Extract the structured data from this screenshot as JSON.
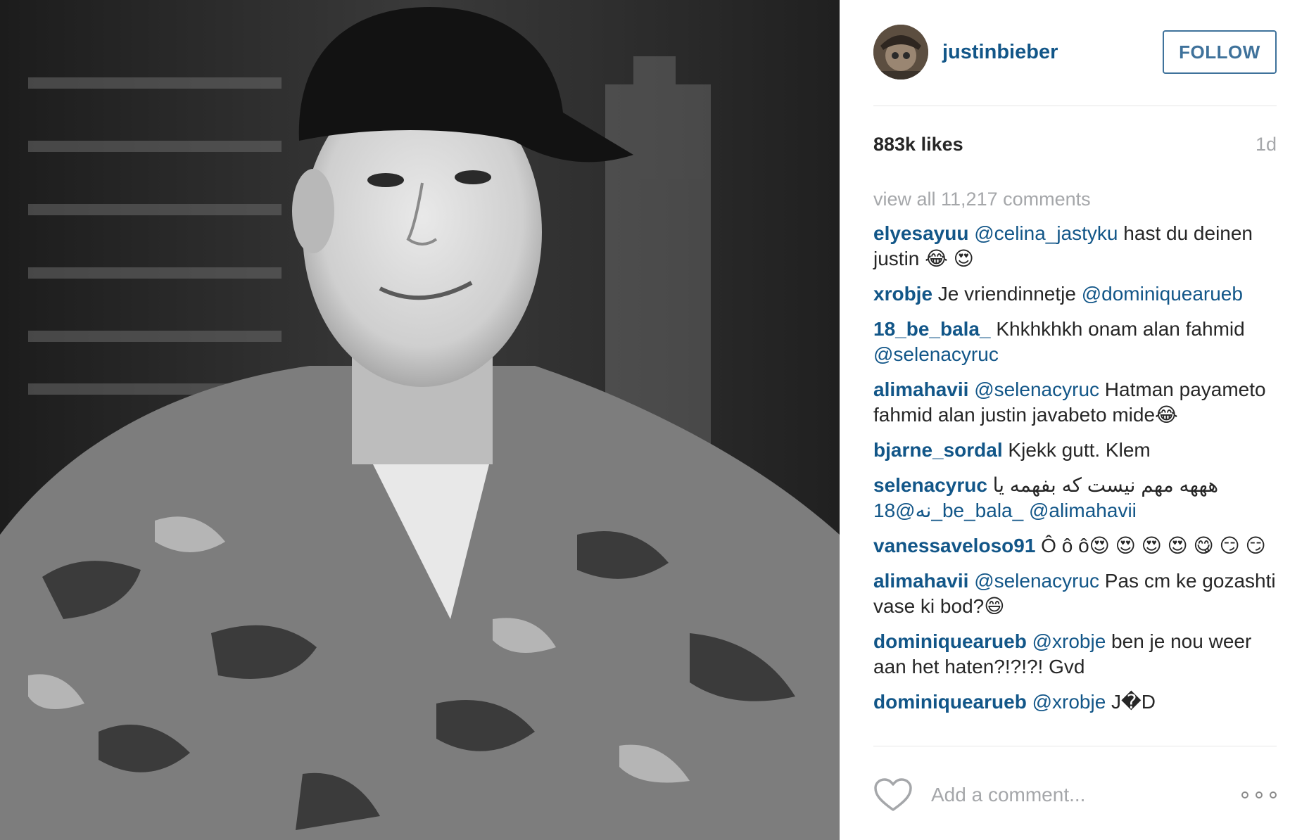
{
  "post": {
    "photo_alt": "Black and white portrait photo"
  },
  "header": {
    "username": "justinbieber",
    "follow_label": "FOLLOW"
  },
  "stats": {
    "likes": "883k likes",
    "time": "1d"
  },
  "view_all": "view all 11,217 comments",
  "comments": [
    {
      "user": "elyesayuu",
      "mention": "@celina_jastyku",
      "text": " hast du deinen justin 😂 😍"
    },
    {
      "user": "xrobje",
      "mention": "",
      "text": " Je vriendinnetje ",
      "mention2": "@dominiquearueb"
    },
    {
      "user": "18_be_bala_",
      "mention": "",
      "text": " Khkhkhkh onam alan fahmid ",
      "mention2": "@selenacyruc"
    },
    {
      "user": "alimahavii",
      "mention": "@selenacyruc",
      "text": " Hatman payameto fahmid alan justin javabeto mide😂"
    },
    {
      "user": "bjarne_sordal",
      "mention": "",
      "text": " Kjekk gutt. Klem"
    },
    {
      "user": "selenacyruc",
      "mention": "",
      "text": " هههه مهم نیست که بفهمه یا ",
      "mention2": "18@نه_be_bala_ @alimahavii"
    },
    {
      "user": "vanessaveloso91",
      "mention": "",
      "text": " Ô ô ô😍 😍 😍 😍 😋 😏 😏"
    },
    {
      "user": "alimahavii",
      "mention": "@selenacyruc",
      "text": " Pas cm ke gozashti vase ki bod?😄"
    },
    {
      "user": "dominiquearueb",
      "mention": "@xrobje",
      "text": " ben je nou weer aan het haten?!?!?! Gvd"
    },
    {
      "user": "dominiquearueb",
      "mention": "@xrobje",
      "text": " J�D"
    }
  ],
  "add_comment": {
    "placeholder": "Add a comment..."
  },
  "icons": {
    "like": "heart-icon",
    "more": "more-options-icon"
  },
  "colors": {
    "link": "#125688",
    "follow": "#3f729b",
    "muted": "#a5a7aa",
    "text": "#262626"
  }
}
